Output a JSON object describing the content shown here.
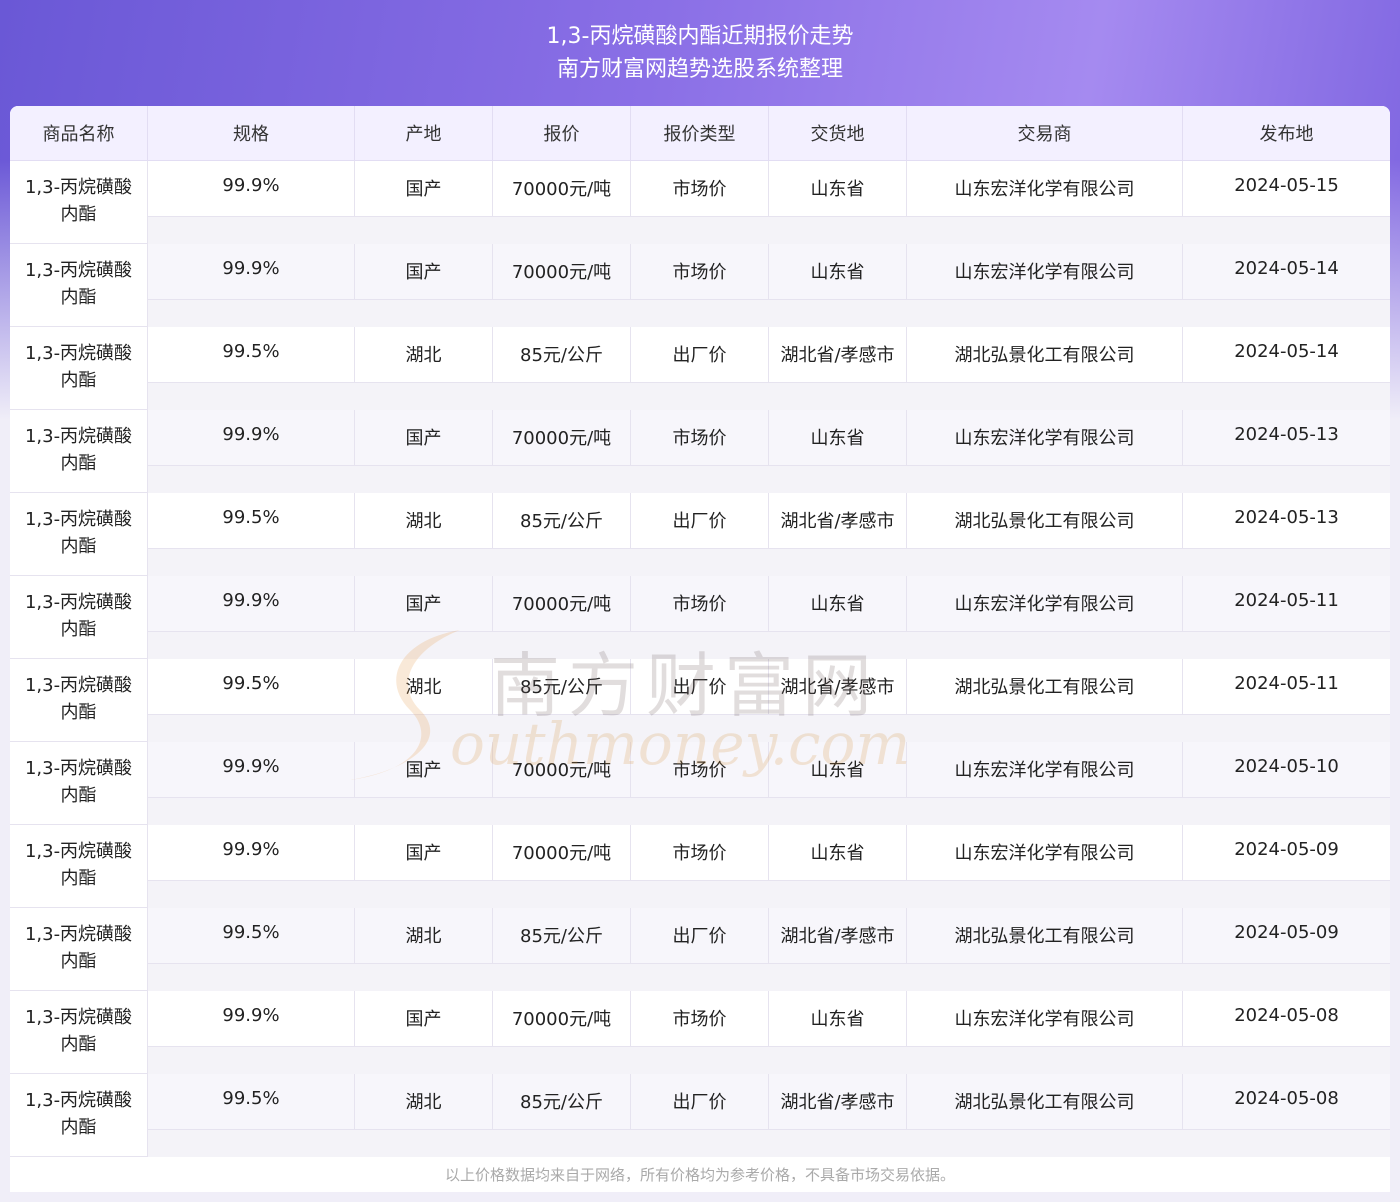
{
  "header": {
    "title_line1": "1,3-丙烷磺酸内酯近期报价走势",
    "title_line2": "南方财富网趋势选股系统整理"
  },
  "table": {
    "columns": [
      "商品名称",
      "规格",
      "产地",
      "报价",
      "报价类型",
      "交货地",
      "交易商",
      "发布地"
    ],
    "rows": [
      {
        "name": "1,3-丙烷磺酸内酯",
        "spec": "99.9%",
        "origin": "国产",
        "price": "70000元/吨",
        "price_type": "市场价",
        "delivery": "山东省",
        "trader": "山东宏洋化学有限公司",
        "date": "2024-05-15"
      },
      {
        "name": "1,3-丙烷磺酸内酯",
        "spec": "99.9%",
        "origin": "国产",
        "price": "70000元/吨",
        "price_type": "市场价",
        "delivery": "山东省",
        "trader": "山东宏洋化学有限公司",
        "date": "2024-05-14"
      },
      {
        "name": "1,3-丙烷磺酸内酯",
        "spec": "99.5%",
        "origin": "湖北",
        "price": "85元/公斤",
        "price_type": "出厂价",
        "delivery": "湖北省/孝感市",
        "trader": "湖北弘景化工有限公司",
        "date": "2024-05-14"
      },
      {
        "name": "1,3-丙烷磺酸内酯",
        "spec": "99.9%",
        "origin": "国产",
        "price": "70000元/吨",
        "price_type": "市场价",
        "delivery": "山东省",
        "trader": "山东宏洋化学有限公司",
        "date": "2024-05-13"
      },
      {
        "name": "1,3-丙烷磺酸内酯",
        "spec": "99.5%",
        "origin": "湖北",
        "price": "85元/公斤",
        "price_type": "出厂价",
        "delivery": "湖北省/孝感市",
        "trader": "湖北弘景化工有限公司",
        "date": "2024-05-13"
      },
      {
        "name": "1,3-丙烷磺酸内酯",
        "spec": "99.9%",
        "origin": "国产",
        "price": "70000元/吨",
        "price_type": "市场价",
        "delivery": "山东省",
        "trader": "山东宏洋化学有限公司",
        "date": "2024-05-11"
      },
      {
        "name": "1,3-丙烷磺酸内酯",
        "spec": "99.5%",
        "origin": "湖北",
        "price": "85元/公斤",
        "price_type": "出厂价",
        "delivery": "湖北省/孝感市",
        "trader": "湖北弘景化工有限公司",
        "date": "2024-05-11"
      },
      {
        "name": "1,3-丙烷磺酸内酯",
        "spec": "99.9%",
        "origin": "国产",
        "price": "70000元/吨",
        "price_type": "市场价",
        "delivery": "山东省",
        "trader": "山东宏洋化学有限公司",
        "date": "2024-05-10"
      },
      {
        "name": "1,3-丙烷磺酸内酯",
        "spec": "99.9%",
        "origin": "国产",
        "price": "70000元/吨",
        "price_type": "市场价",
        "delivery": "山东省",
        "trader": "山东宏洋化学有限公司",
        "date": "2024-05-09"
      },
      {
        "name": "1,3-丙烷磺酸内酯",
        "spec": "99.5%",
        "origin": "湖北",
        "price": "85元/公斤",
        "price_type": "出厂价",
        "delivery": "湖北省/孝感市",
        "trader": "湖北弘景化工有限公司",
        "date": "2024-05-09"
      },
      {
        "name": "1,3-丙烷磺酸内酯",
        "spec": "99.9%",
        "origin": "国产",
        "price": "70000元/吨",
        "price_type": "市场价",
        "delivery": "山东省",
        "trader": "山东宏洋化学有限公司",
        "date": "2024-05-08"
      },
      {
        "name": "1,3-丙烷磺酸内酯",
        "spec": "99.5%",
        "origin": "湖北",
        "price": "85元/公斤",
        "price_type": "出厂价",
        "delivery": "湖北省/孝感市",
        "trader": "湖北弘景化工有限公司",
        "date": "2024-05-08"
      }
    ]
  },
  "footer": {
    "note": "以上价格数据均来自于网络，所有价格均为参考价格，不具备市场交易依据。"
  },
  "watermark": {
    "text_cn": "南方财富网",
    "text_en": "outhmoney.com"
  }
}
